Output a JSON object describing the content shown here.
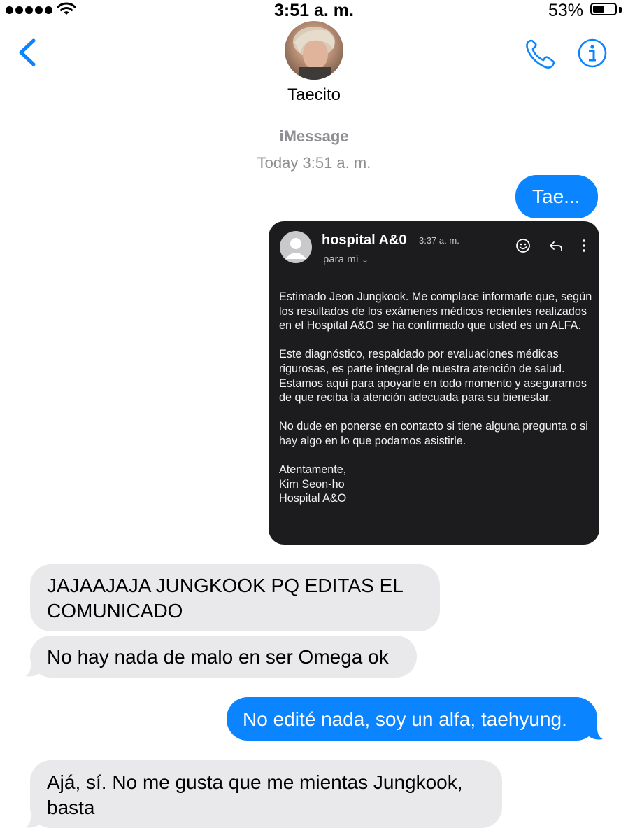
{
  "status_bar": {
    "time": "3:51 a. m.",
    "battery_pct": "53%",
    "battery_level": 0.53
  },
  "header": {
    "contact_name": "Taecito"
  },
  "conversation": {
    "service": "iMessage",
    "timestamp": "Today 3:51 a. m.",
    "messages": [
      {
        "from": "me",
        "text": "Tae..."
      },
      {
        "from": "me",
        "type": "image",
        "email": {
          "sender": "hospital A&0",
          "time": "3:37 a. m.",
          "to": "para mí",
          "paragraphs": [
            "Estimado Jeon Jungkook. Me complace informarle que, según los resultados de los exámenes médicos recientes realizados en el Hospital A&O se ha confirmado que usted es un ALFA.",
            "Este diagnóstico, respaldado por evaluaciones médicas rigurosas, es parte integral de nuestra atención de salud. Estamos aquí para apoyarle en todo momento y asegurarnos de que reciba la atención adecuada para su bienestar.",
            "No dude en ponerse en contacto si tiene alguna pregunta o si hay algo en lo que podamos asistirle."
          ],
          "signature": [
            "Atentamente,",
            "Kim Seon-ho",
            "Hospital A&O"
          ]
        }
      },
      {
        "from": "them",
        "text": "JAJAAJAJA JUNGKOOK PQ EDITAS EL COMUNICADO"
      },
      {
        "from": "them",
        "text": "No hay nada de malo en ser Omega ok"
      },
      {
        "from": "me",
        "text": "No edité nada, soy un alfa, taehyung."
      },
      {
        "from": "them",
        "text": "Ajá, sí. No me gusta que me mientas Jungkook, basta"
      }
    ]
  },
  "colors": {
    "accent": "#0a84ff",
    "incoming_bubble": "#e9e9eb",
    "email_bg": "#1c1c1e",
    "meta_text": "#8e8e93"
  }
}
